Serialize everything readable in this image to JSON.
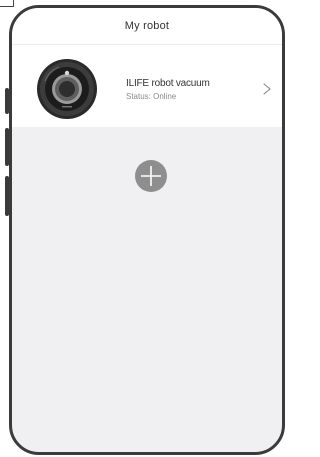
{
  "header": {
    "title": "My robot"
  },
  "device": {
    "name": "ILIFE robot vacuum",
    "status": "Status: Online",
    "image_icon": "robot-vacuum",
    "chevron_icon": "chevron-right"
  },
  "add_device": {
    "icon": "plus-circle"
  },
  "colors": {
    "frame": "#3b3b3b",
    "background": "#f0f0f2",
    "card": "#ffffff",
    "add_button": "#8e8e8e",
    "text_primary": "#333333",
    "text_secondary": "#8a8a8a"
  }
}
